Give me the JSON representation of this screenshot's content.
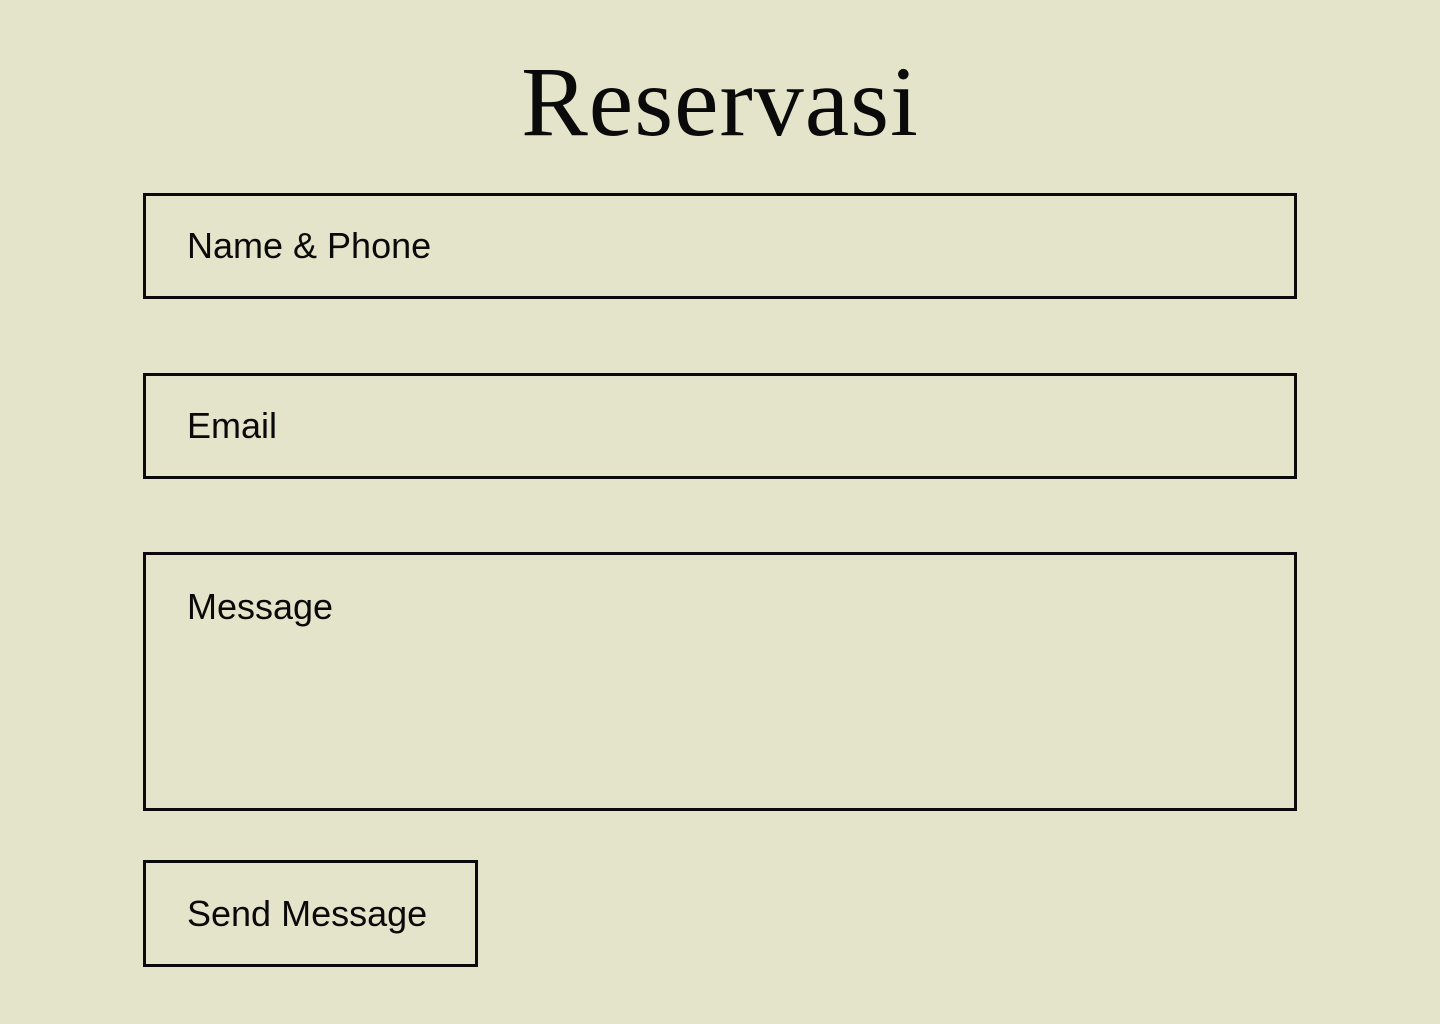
{
  "page": {
    "title": "Reservasi",
    "background_color": "#e4e4cb",
    "text_color": "#0a0a0a"
  },
  "form": {
    "name_phone": {
      "value": "",
      "placeholder": "Name & Phone"
    },
    "email": {
      "value": "",
      "placeholder": "Email"
    },
    "message": {
      "value": "",
      "placeholder": "Message"
    },
    "submit_label": "Send Message"
  }
}
